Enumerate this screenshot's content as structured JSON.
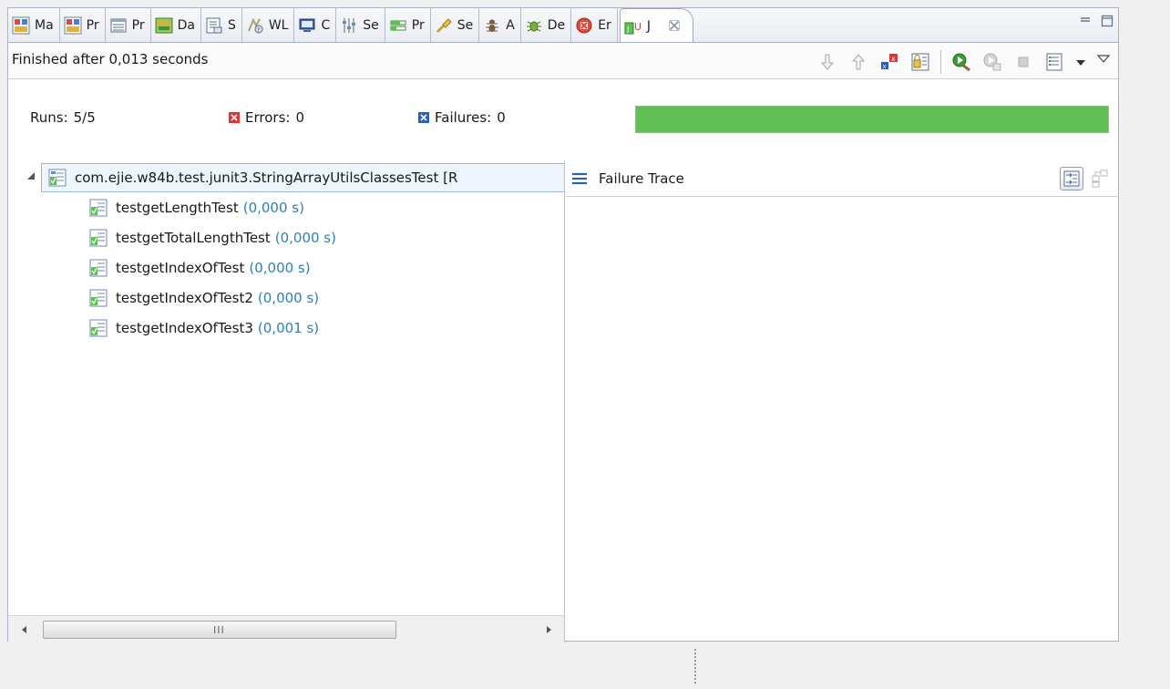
{
  "tabs": [
    {
      "label": "Ma",
      "icon": "markers-icon"
    },
    {
      "label": "Pr",
      "icon": "properties-icon"
    },
    {
      "label": "Pr",
      "icon": "problems-icon"
    },
    {
      "label": "Da",
      "icon": "data-source-icon"
    },
    {
      "label": "S",
      "icon": "snippets-icon"
    },
    {
      "label": "WL",
      "icon": "weblogic-icon"
    },
    {
      "label": "C",
      "icon": "console-icon"
    },
    {
      "label": "Se",
      "icon": "servers-icon"
    },
    {
      "label": "Pr",
      "icon": "progress-icon"
    },
    {
      "label": "Se",
      "icon": "search-icon"
    },
    {
      "label": "A",
      "icon": "ant-icon"
    },
    {
      "label": "De",
      "icon": "debug-icon"
    },
    {
      "label": "Er",
      "icon": "error-log-icon"
    }
  ],
  "active_tab": {
    "label": "J",
    "icon": "junit-icon"
  },
  "status": {
    "text": "Finished after 0,013 seconds"
  },
  "counters": {
    "runs_label": "Runs:",
    "runs_value": "5/5",
    "errors_label": "Errors:",
    "errors_value": "0",
    "failures_label": "Failures:",
    "failures_value": "0"
  },
  "progress": {
    "fraction": 1.0,
    "color": "#5fbf52"
  },
  "tree": {
    "root": "com.ejie.w84b.test.junit3.StringArrayUtilsClassesTest [R",
    "items": [
      {
        "name": "testgetLengthTest",
        "time": "(0,000 s)"
      },
      {
        "name": "testgetTotalLengthTest",
        "time": "(0,000 s)"
      },
      {
        "name": "testgetIndexOfTest",
        "time": "(0,000 s)"
      },
      {
        "name": "testgetIndexOfTest2",
        "time": "(0,000 s)"
      },
      {
        "name": "testgetIndexOfTest3",
        "time": "(0,001 s)"
      }
    ],
    "scroll_grip": "III"
  },
  "trace": {
    "title": "Failure Trace"
  },
  "colors": {
    "accent": "#2f7fb7",
    "success": "#5fbf52",
    "error": "#e03434",
    "failure": "#2c5fb5"
  }
}
